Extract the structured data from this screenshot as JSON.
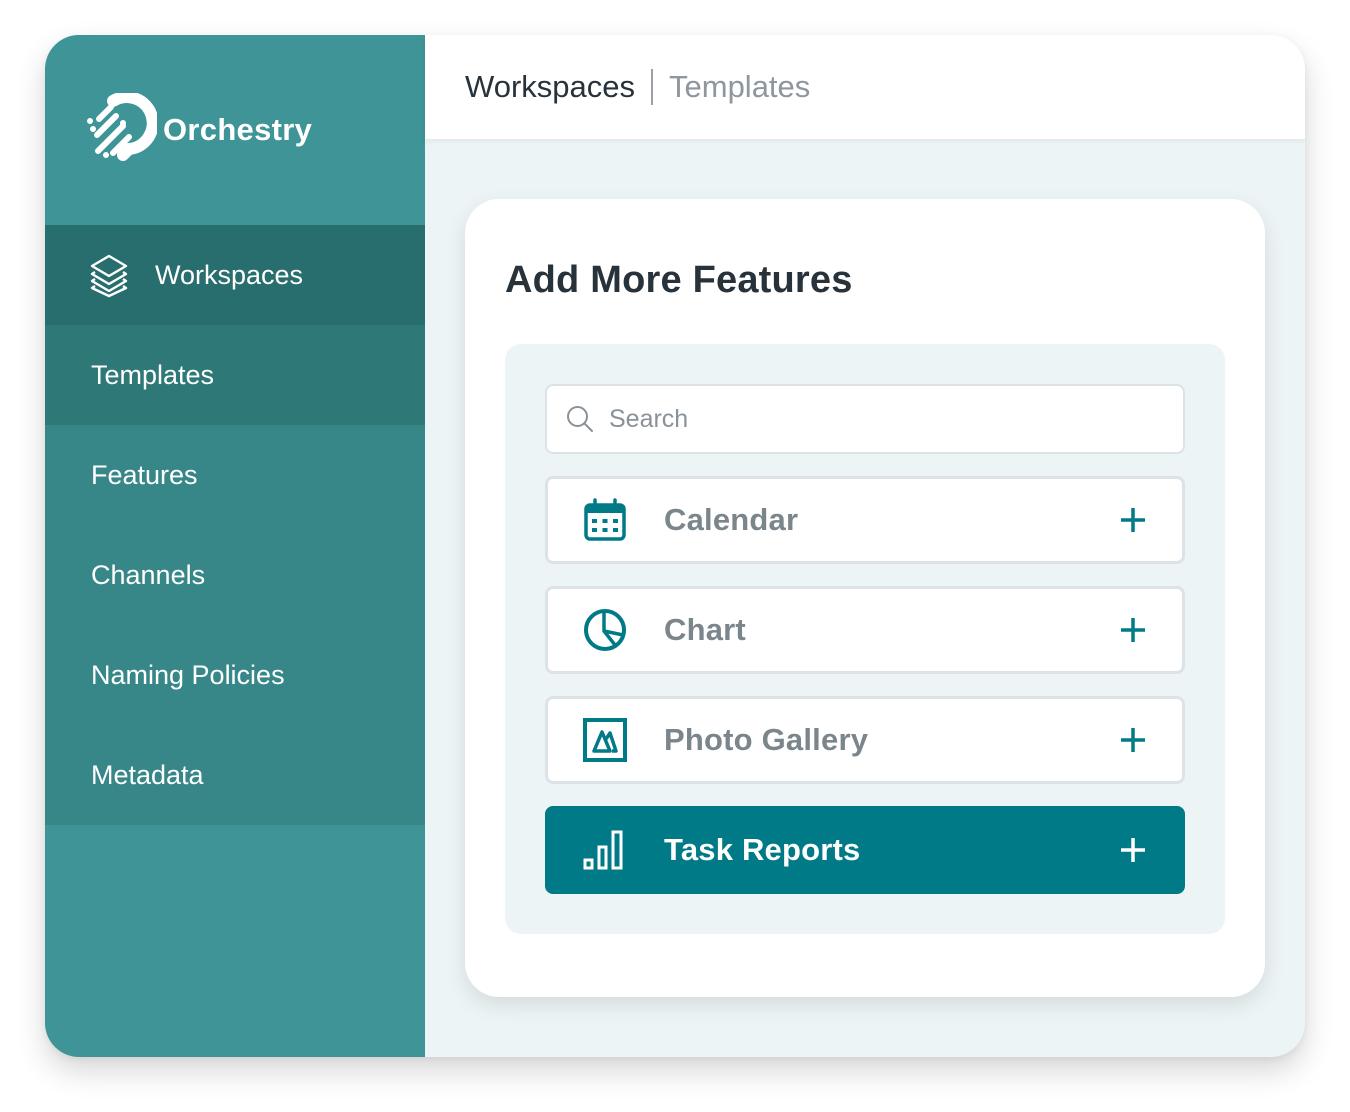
{
  "brand": {
    "name": "Orchestry",
    "logo_icon": "orchestry-comet-logo",
    "color": "#3e9496"
  },
  "sidebar": {
    "items": [
      {
        "label": "Workspaces",
        "icon": "layers-icon",
        "state": "active"
      },
      {
        "label": "Templates",
        "state": "sub-active"
      },
      {
        "label": "Features",
        "state": "default"
      },
      {
        "label": "Channels",
        "state": "default"
      },
      {
        "label": "Naming Policies",
        "state": "default"
      },
      {
        "label": "Metadata",
        "state": "default"
      }
    ]
  },
  "breadcrumb": {
    "items": [
      {
        "label": "Workspaces",
        "current": true
      },
      {
        "label": "Templates",
        "current": false
      }
    ]
  },
  "card": {
    "title": "Add More Features",
    "search": {
      "placeholder": "Search",
      "value": "",
      "icon": "search-icon"
    },
    "features": [
      {
        "label": "Calendar",
        "icon": "calendar-icon",
        "action": "add",
        "selected": false
      },
      {
        "label": "Chart",
        "icon": "pie-chart-icon",
        "action": "add",
        "selected": false
      },
      {
        "label": "Photo Gallery",
        "icon": "image-icon",
        "action": "add",
        "selected": false
      },
      {
        "label": "Task Reports",
        "icon": "bar-chart-icon",
        "action": "add",
        "selected": true
      }
    ]
  },
  "colors": {
    "accent": "#007a86",
    "sidebar_bg": "#3e9496",
    "sidebar_active": "#296e6e",
    "sidebar_sub_active": "#2e7878",
    "sidebar_item": "#378789",
    "content_bg": "#ecf4f6",
    "title_text": "#28323a",
    "muted_text": "#8e969e"
  }
}
